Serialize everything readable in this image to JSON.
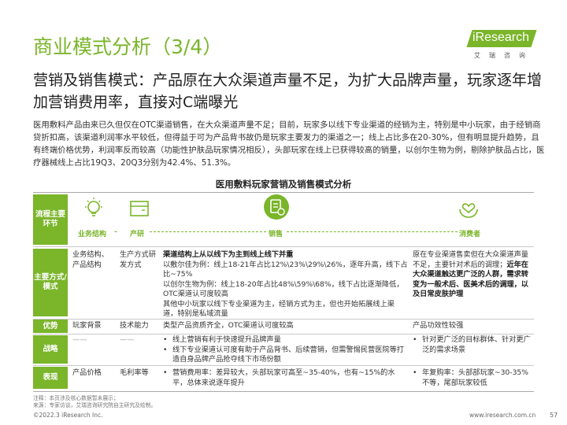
{
  "header": {
    "title": "商业模式分析（3/4）",
    "logo_text": "iResearch",
    "logo_sub": "艾瑞咨询"
  },
  "subtitle": "营销及销售模式：产品原在大众渠道声量不足，为扩大品牌声量，玩家逐年增加营销费用率，直接对C端曝光",
  "body_text": "医用敷料产品由来已久但仅在OTC渠道销售，在大众渠道声量不足；目前，玩家多以线下专业渠道的经销为主，特别是中小玩家，由于经销商贷折扣高，该渠道利润率水平较低，但得益于可为产品背书故仍是玩家主要发力的渠道之一；线上占比多在20-30%，但有明显提升趋势，且有终端价格优势，利润率反而较高（功能性护肤品玩家情况相反），头部玩家在线上已获得较高的销量，以创尔生物为例，剔除护肤品占比，医疗器械线上占比19Q3、20Q3分别为42.4%、51.3%。",
  "section_title": "医用敷料玩家营销及销售模式分析",
  "flow": {
    "row_label": "流程主要环节",
    "steps": [
      "业务结构",
      "产研",
      "销售",
      "消费者"
    ],
    "dash": "-"
  },
  "table": {
    "rows": [
      {
        "label": "主要方式/模式",
        "c1": "业务结构、产品结构",
        "c2": "生产方式研发方式",
        "c3_bold": "渠道结构上从以线下为主到线上线下并重",
        "c3_lines": [
          "以敷尔佳为例：线上18-21年占比12%\\23%\\29%\\26%，逐年升高，线下占比~75%",
          "以创尔生物为例：线上18-20年占比48%\\59%\\68%，线下占比逐渐降低，OTC渠道认可度较高",
          "其他中小玩家以线下专业渠道为主，经销方式为主，但也开始拓展线上渠道，特别是私域流量"
        ],
        "c4_normal": "原在专业渠道售卖但在大众渠道声量不足，主要针对术后的调理；",
        "c4_bold": "近年在大众渠道触达更广泛的人群，需求转变为一般术后、医美术后的调理，以及日常皮肤护理"
      },
      {
        "label": "优势",
        "c1": "玩家背景",
        "c2": "技术能力",
        "c3": "类型产品资质齐全，OTC渠道认可度较高",
        "c4": "产品功效性较强"
      },
      {
        "label": "战略",
        "c1": "——",
        "c2": "——",
        "c3_bullets": [
          "线上营销有利于快速提升品牌声量",
          "线下专业渠道认可度有助于产品背书、后续营销，但需警惕民营医院等打造自身品牌产品抢夺线下市场份额"
        ],
        "c4_bullets": [
          "针对更广泛的目标群体、针对更广泛的需求场景"
        ]
      },
      {
        "label": "表现",
        "c1": "产品价格",
        "c2": "毛利率等",
        "c3_bullets": [
          "营销费用率：差异较大，头部玩家可高至~35-40%，也有~15%的水平，总体来说逐年提升"
        ],
        "c4_bullets": [
          "年复购率：头部部玩家~30-35%不等，尾部玩家较低"
        ]
      }
    ]
  },
  "footer": {
    "note1": "注释：本页涉及核心数据暂未展示；",
    "note2": "来源：专家访谈，艾瑞咨询研究院自主研究及绘制。",
    "copyright": "©2022.3 iResearch Inc.",
    "website": "www.iresearch.com.cn",
    "page": "57"
  },
  "colors": {
    "accent": "#7ab52a",
    "text": "#333333"
  }
}
